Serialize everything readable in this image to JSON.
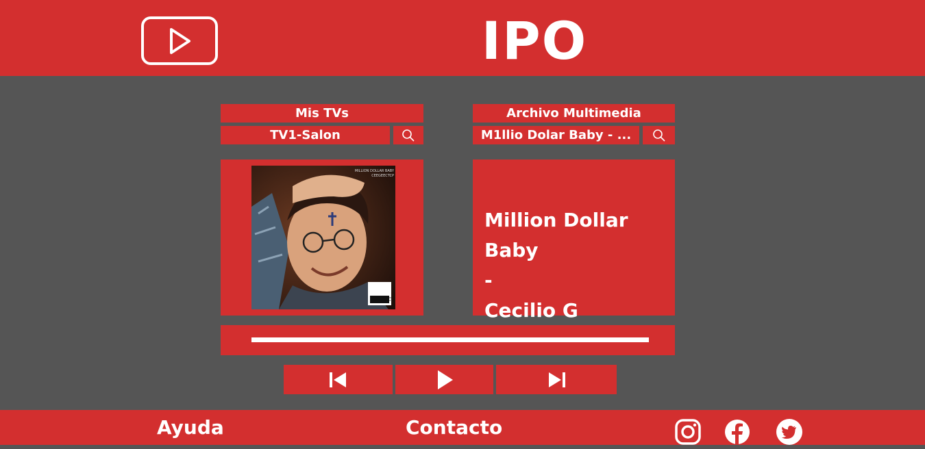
{
  "app": {
    "brand": "IPO",
    "accent_color": "#d32f2f",
    "background_color": "#555555",
    "logo_icon": "play-logo-icon"
  },
  "tvs_panel": {
    "title": "Mis TVs",
    "selected": "TV1-Salon",
    "search_icon": "search-icon"
  },
  "media_panel": {
    "title": "Archivo Multimedia",
    "selected": "M1llio Dolar Baby - ...",
    "search_icon": "search-icon"
  },
  "now_playing": {
    "song": "Million Dollar Baby",
    "separator": "-",
    "artist": "Cecilio G",
    "cover_title": "MILLION DOLLAR BABY",
    "cover_artist": "CEEGEECTCP",
    "cover_badge": "PARENTAL ADVISORY EXPLICIT CONTENT",
    "progress": 1.0
  },
  "controls": {
    "previous_icon": "skip-previous-icon",
    "play_icon": "play-icon",
    "next_icon": "skip-next-icon"
  },
  "footer": {
    "help": "Ayuda",
    "contact": "Contacto",
    "social": [
      "instagram-icon",
      "facebook-icon",
      "twitter-icon"
    ]
  }
}
